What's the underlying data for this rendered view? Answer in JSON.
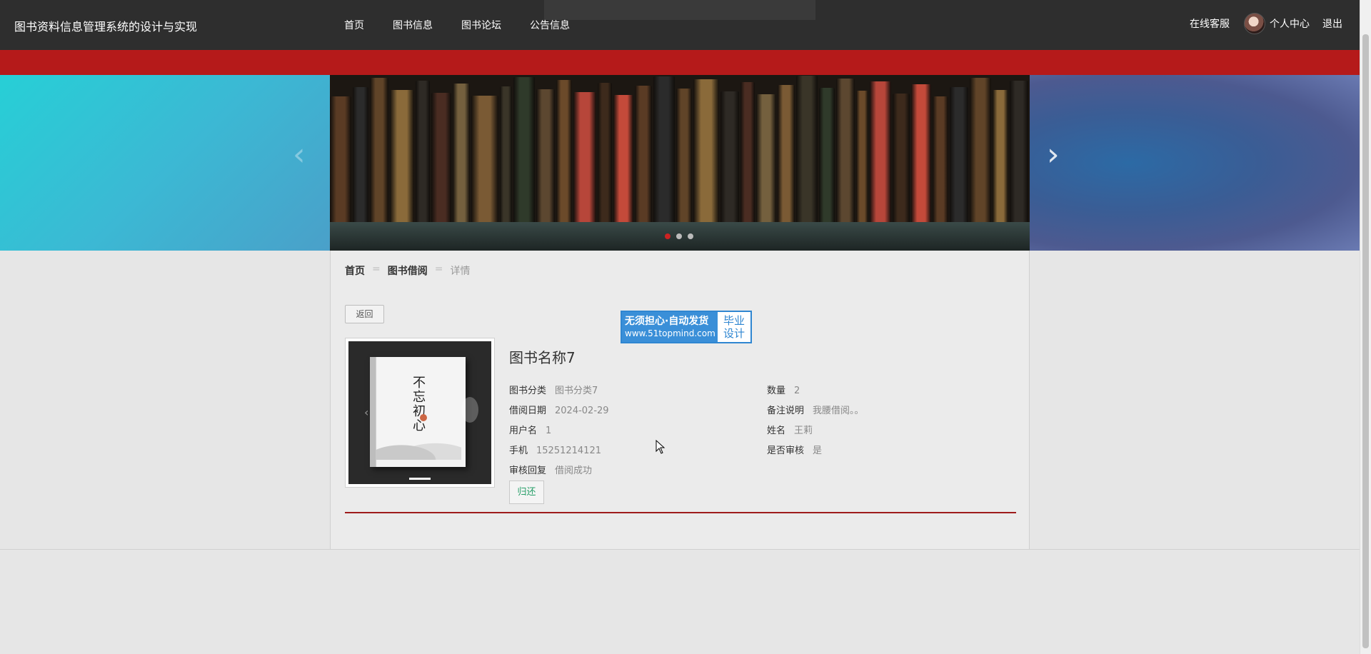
{
  "header": {
    "site_title": "图书资料信息管理系统的设计与实现",
    "nav": [
      "首页",
      "图书信息",
      "图书论坛",
      "公告信息"
    ],
    "online_service": "在线客服",
    "personal_center": "个人中心",
    "logout": "退出"
  },
  "banner": {
    "prev": "‹",
    "next": "›",
    "slide_count": 3,
    "active_slide": 1
  },
  "breadcrumb": {
    "home": "首页",
    "section": "图书借阅",
    "current": "详情",
    "separator": "="
  },
  "back_label": "返回",
  "watermark": {
    "line1": "无须担心·自动发货",
    "line2": "www.51topmind.com",
    "side1": "毕业",
    "side2": "设计"
  },
  "cover": {
    "title_text": "不忘初心"
  },
  "detail": {
    "book_name": "图书名称7",
    "category_label": "图书分类",
    "category_value": "图书分类7",
    "quantity_label": "数量",
    "quantity_value": "2",
    "borrow_date_label": "借阅日期",
    "borrow_date_value": "2024-02-29",
    "remark_label": "备注说明",
    "remark_value": "我腰借阅。。",
    "username_label": "用户名",
    "username_value": "1",
    "name_label": "姓名",
    "name_value": "王莉",
    "phone_label": "手机",
    "phone_value": "15251214121",
    "reviewed_label": "是否审核",
    "reviewed_value": "是",
    "review_reply_label": "审核回复",
    "review_reply_value": "借阅成功"
  },
  "return_label": "归还",
  "colors": {
    "topbar": "#2e2e2e",
    "redbar": "#b51a1a",
    "divider": "#9e1b1b",
    "return_text": "#2aa06a",
    "watermark_blue": "#3a8fd8"
  }
}
